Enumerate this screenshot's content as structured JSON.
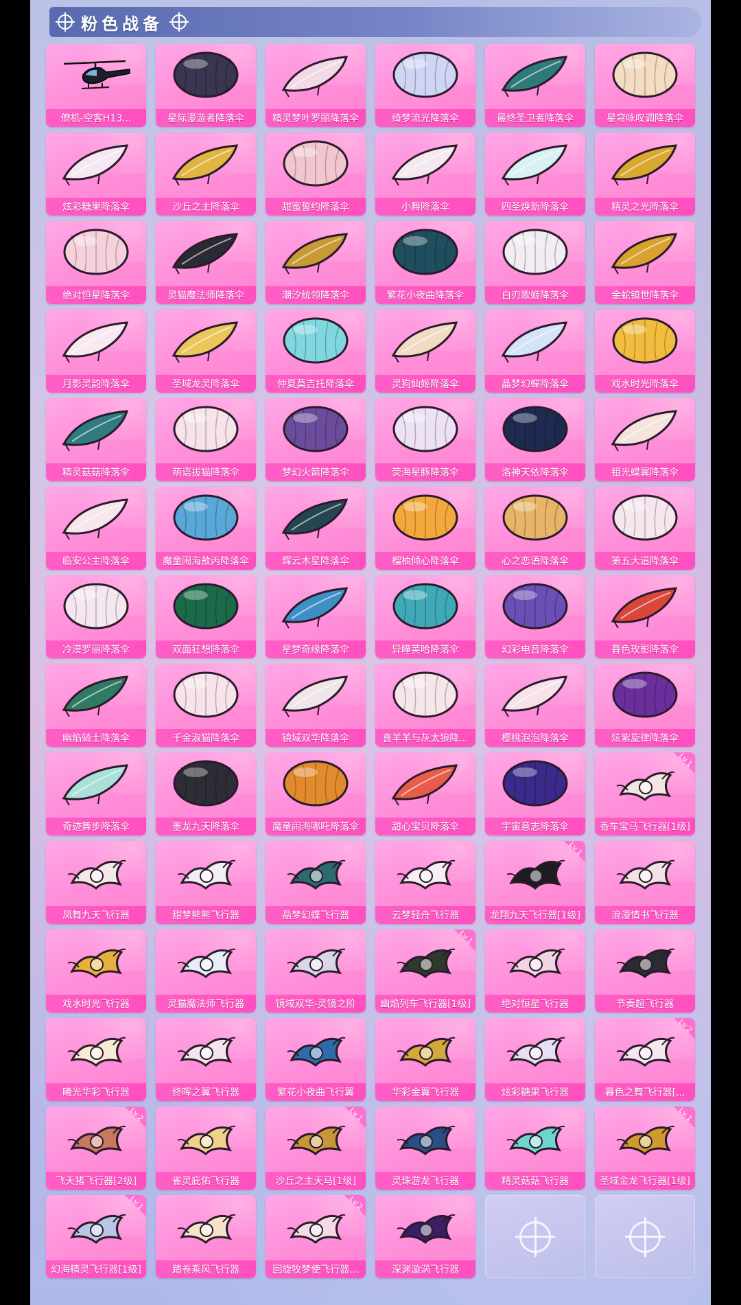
{
  "header": {
    "title": "粉色战备"
  },
  "items": [
    {
      "name": "僚机-空客H13...",
      "kind": "helicopter",
      "color": "#1b1f2a"
    },
    {
      "name": "星际漫游者降落伞",
      "kind": "round",
      "color": "#3a3550"
    },
    {
      "name": "精灵梦叶罗丽降落伞",
      "kind": "wing",
      "color": "#f2d9e6"
    },
    {
      "name": "绮梦流光降落伞",
      "kind": "round",
      "color": "#cfd6f5"
    },
    {
      "name": "最终圣卫者降落伞",
      "kind": "wing",
      "color": "#2c7a7a"
    },
    {
      "name": "星穹咏叹调降落伞",
      "kind": "round",
      "color": "#f3dcc1"
    },
    {
      "name": "炫彩糖果降落伞",
      "kind": "wing",
      "color": "#f5e8f2"
    },
    {
      "name": "沙丘之主降落伞",
      "kind": "wing",
      "color": "#e0b640"
    },
    {
      "name": "甜蜜誓约降落伞",
      "kind": "round",
      "color": "#f2c6cf"
    },
    {
      "name": "小舞降落伞",
      "kind": "wing",
      "color": "#f4e9ef"
    },
    {
      "name": "四圣焕新降落伞",
      "kind": "wing",
      "color": "#d8f1f2"
    },
    {
      "name": "精灵之光降落伞",
      "kind": "wing",
      "color": "#d8a830"
    },
    {
      "name": "绝对恒星降落伞",
      "kind": "round",
      "color": "#f6d1dc"
    },
    {
      "name": "灵猫魔法师降落伞",
      "kind": "wing",
      "color": "#2a2a33"
    },
    {
      "name": "潮汐统领降落伞",
      "kind": "wing",
      "color": "#c79a36"
    },
    {
      "name": "繁花小夜曲降落伞",
      "kind": "round",
      "color": "#1f4f5f"
    },
    {
      "name": "白刃歌姬降落伞",
      "kind": "round",
      "color": "#f1edf3"
    },
    {
      "name": "金蛇镇世降落伞",
      "kind": "wing",
      "color": "#d8a22e"
    },
    {
      "name": "月影灵韵降落伞",
      "kind": "wing",
      "color": "#f7e9ef"
    },
    {
      "name": "圣域龙灵降落伞",
      "kind": "wing",
      "color": "#ebc75b"
    },
    {
      "name": "仲夏莫吉托降落伞",
      "kind": "round",
      "color": "#7fd7df"
    },
    {
      "name": "灵狗仙姬降落伞",
      "kind": "wing",
      "color": "#f0dcc4"
    },
    {
      "name": "晶梦幻蝶降落伞",
      "kind": "wing",
      "color": "#d4e4f8"
    },
    {
      "name": "戏水时光降落伞",
      "kind": "round",
      "color": "#f2bd3e"
    },
    {
      "name": "精灵菇菇降落伞",
      "kind": "wing",
      "color": "#2f7b80"
    },
    {
      "name": "萌语拔猫降落伞",
      "kind": "round",
      "color": "#f6e4ea"
    },
    {
      "name": "梦幻火箭降落伞",
      "kind": "round",
      "color": "#6b4c9c"
    },
    {
      "name": "荧海星豚降落伞",
      "kind": "round",
      "color": "#ece1f5"
    },
    {
      "name": "洛神天依降落伞",
      "kind": "round",
      "color": "#1f2a52"
    },
    {
      "name": "钼光蝶翼降落伞",
      "kind": "wing",
      "color": "#f5e3dd"
    },
    {
      "name": "临安公主降落伞",
      "kind": "wing",
      "color": "#f7e6ec"
    },
    {
      "name": "魔童闹海敖丙降落伞",
      "kind": "round",
      "color": "#5aa7d9"
    },
    {
      "name": "辉云木星降落伞",
      "kind": "wing",
      "color": "#234651"
    },
    {
      "name": "榴柚倾心降落伞",
      "kind": "round",
      "color": "#f3a83b"
    },
    {
      "name": "心之恋语降落伞",
      "kind": "round",
      "color": "#e8b467"
    },
    {
      "name": "第五大道降落伞",
      "kind": "round",
      "color": "#f6e7ee"
    },
    {
      "name": "冷漠罗丽降落伞",
      "kind": "round",
      "color": "#f5e7ef"
    },
    {
      "name": "双面狂想降落伞",
      "kind": "round",
      "color": "#1b6b4b"
    },
    {
      "name": "星梦奇缘降落伞",
      "kind": "wing",
      "color": "#3f8fc7"
    },
    {
      "name": "异瞳荚哈降落伞",
      "kind": "round",
      "color": "#3fa9b8"
    },
    {
      "name": "幻彩电音降落伞",
      "kind": "round",
      "color": "#6a4fb5"
    },
    {
      "name": "暮色玫影降落伞",
      "kind": "wing",
      "color": "#d9473b"
    },
    {
      "name": "幽焰骑士降落伞",
      "kind": "wing",
      "color": "#2f7a63"
    },
    {
      "name": "千金淑猫降落伞",
      "kind": "round",
      "color": "#f7e3ea"
    },
    {
      "name": "镜域双华降落伞",
      "kind": "wing",
      "color": "#f0e6ea"
    },
    {
      "name": "喜羊羊与灰太狼降...",
      "kind": "round",
      "color": "#f5e7e9"
    },
    {
      "name": "樱桃泡泡降落伞",
      "kind": "wing",
      "color": "#f7e2ea"
    },
    {
      "name": "炫紫旋律降落伞",
      "kind": "round",
      "color": "#6a2f9c"
    },
    {
      "name": "奇迹舞步降落伞",
      "kind": "wing",
      "color": "#a9e0d8"
    },
    {
      "name": "墨龙九天降落伞",
      "kind": "round",
      "color": "#2d2d36"
    },
    {
      "name": "魔童闹海哪吒降落伞",
      "kind": "round",
      "color": "#e38a2e"
    },
    {
      "name": "甜心宝贝降落伞",
      "kind": "wing",
      "color": "#e85c4a"
    },
    {
      "name": "宇宙意志降落伞",
      "kind": "round",
      "color": "#3b2a8a"
    },
    {
      "name": "香车宝马飞行器[1级]",
      "kind": "flyer",
      "color": "#f1e6e1",
      "badge": "Lv.1"
    },
    {
      "name": "凤舞九天飞行器",
      "kind": "flyer",
      "color": "#f3e9e6"
    },
    {
      "name": "甜梦熊熊飞行器",
      "kind": "flyer",
      "color": "#f2eef6"
    },
    {
      "name": "晶梦幻蝶飞行器",
      "kind": "flyer",
      "color": "#2b6b71"
    },
    {
      "name": "云梦轻舟飞行器",
      "kind": "flyer",
      "color": "#f6eef2"
    },
    {
      "name": "龙翔九天飞行器[1级]",
      "kind": "flyer",
      "color": "#1c1c22",
      "badge": "Lv.1"
    },
    {
      "name": "浪漫情书飞行器",
      "kind": "flyer",
      "color": "#f4e1e6"
    },
    {
      "name": "戏水时光飞行器",
      "kind": "flyer",
      "color": "#e8b03a"
    },
    {
      "name": "灵猫魔法师飞行器",
      "kind": "flyer",
      "color": "#e6eef6"
    },
    {
      "name": "镜域双华-灵镜之阶",
      "kind": "flyer",
      "color": "#d9d6e8"
    },
    {
      "name": "幽焰列车飞行器[1级]",
      "kind": "flyer",
      "color": "#2f3a2a",
      "badge": "Lv.1"
    },
    {
      "name": "绝对恒星飞行器",
      "kind": "flyer",
      "color": "#f2d5e4"
    },
    {
      "name": "节奏超飞行器",
      "kind": "flyer",
      "color": "#2b2b33"
    },
    {
      "name": "曦光华彩飞行器",
      "kind": "flyer",
      "color": "#f7ecd3"
    },
    {
      "name": "终晖之翼飞行器",
      "kind": "flyer",
      "color": "#f2e6ec"
    },
    {
      "name": "繁花小夜曲飞行翼",
      "kind": "flyer",
      "color": "#2d6ca8"
    },
    {
      "name": "华彩金翼飞行器",
      "kind": "flyer",
      "color": "#d5a83b"
    },
    {
      "name": "炫彩糖果飞行器",
      "kind": "flyer",
      "color": "#e8dff5"
    },
    {
      "name": "暮色之舞飞行器[...",
      "kind": "flyer",
      "color": "#f5e7ee",
      "badge": "Lv.2"
    },
    {
      "name": "飞天猪飞行器[2级]",
      "kind": "flyer",
      "color": "#c9775f",
      "badge": "Lv.2"
    },
    {
      "name": "雀灵庇佑飞行器",
      "kind": "flyer",
      "color": "#f0d38a"
    },
    {
      "name": "沙丘之主天马[1级]",
      "kind": "flyer",
      "color": "#c99638",
      "badge": "Lv.1"
    },
    {
      "name": "灵珠游龙飞行器",
      "kind": "flyer",
      "color": "#2a4f86"
    },
    {
      "name": "精灵菇菇飞行器",
      "kind": "flyer",
      "color": "#6fd4cf"
    },
    {
      "name": "圣域金龙飞行器[1级]",
      "kind": "flyer",
      "color": "#d19a2e",
      "badge": "Lv.1"
    },
    {
      "name": "幻海精灵飞行器[1级]",
      "kind": "flyer",
      "color": "#b9c6e6",
      "badge": "Lv.1"
    },
    {
      "name": "踏卷乘风飞行器",
      "kind": "flyer",
      "color": "#f3e4c9"
    },
    {
      "name": "回旋牧梦使飞行器...",
      "kind": "flyer",
      "color": "#f2dbe6",
      "badge": "Lv.2"
    },
    {
      "name": "深渊漩涡飞行器",
      "kind": "flyer",
      "color": "#3a1f66"
    },
    {
      "empty": true
    },
    {
      "empty": true
    }
  ]
}
